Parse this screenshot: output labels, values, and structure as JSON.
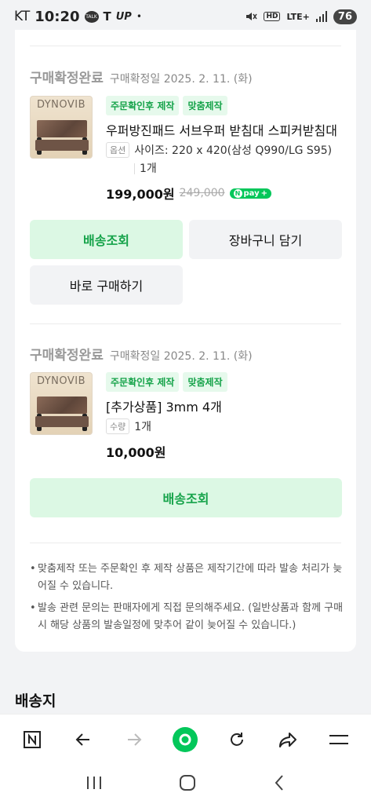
{
  "status_bar": {
    "carrier": "KT",
    "time": "10:20",
    "icons_left": [
      "talk-icon",
      "tesla-icon",
      "up-icon"
    ],
    "dot": "•",
    "hd": "HD",
    "lte": "LTE+",
    "battery": "76"
  },
  "orders": [
    {
      "status": "구매확정완료",
      "date": "구매확정일 2025. 2. 11. (화)",
      "brand": "DYNOVIB",
      "tags": [
        "주문확인후 제작",
        "맞춤제작"
      ],
      "name": "우퍼방진패드 서브우퍼 받침대 스피커받침대",
      "option_label": "옵션",
      "option": "사이즈: 220 x 420(삼성 Q990/LG S95)",
      "qty": "1개",
      "price": "199,000원",
      "original_price": "249,000",
      "npay": "pay",
      "buttons": [
        "배송조회",
        "장바구니 담기",
        "바로 구매하기"
      ]
    },
    {
      "status": "구매확정완료",
      "date": "구매확정일 2025. 2. 11. (화)",
      "brand": "DYNOVIB",
      "tags": [
        "주문확인후 제작",
        "맞춤제작"
      ],
      "name": "[추가상품] 3mm 4개",
      "qty_label": "수량",
      "qty": "1개",
      "price": "10,000원",
      "buttons": [
        "배송조회"
      ]
    }
  ],
  "notes": [
    "맞춤제작 또는 주문확인 후 제작 상품은 제작기간에 따라 발송 처리가 늦어질 수 있습니다.",
    "발송 관련 문의는 판매자에게 직접 문의해주세요. (일반상품과 함께 구매 시 해당 상품의 발송일정에 맞추어 같이 늦어질 수 있습니다.)"
  ],
  "section_title": "배송지",
  "browser_bar": [
    "naver-home-icon",
    "back-icon",
    "forward-icon",
    "green-dot-icon",
    "refresh-icon",
    "share-icon",
    "menu-icon"
  ],
  "colors": {
    "accent_green": "#16a34a",
    "green_bg": "#dcf8e4",
    "naver_green": "#03c75a"
  }
}
